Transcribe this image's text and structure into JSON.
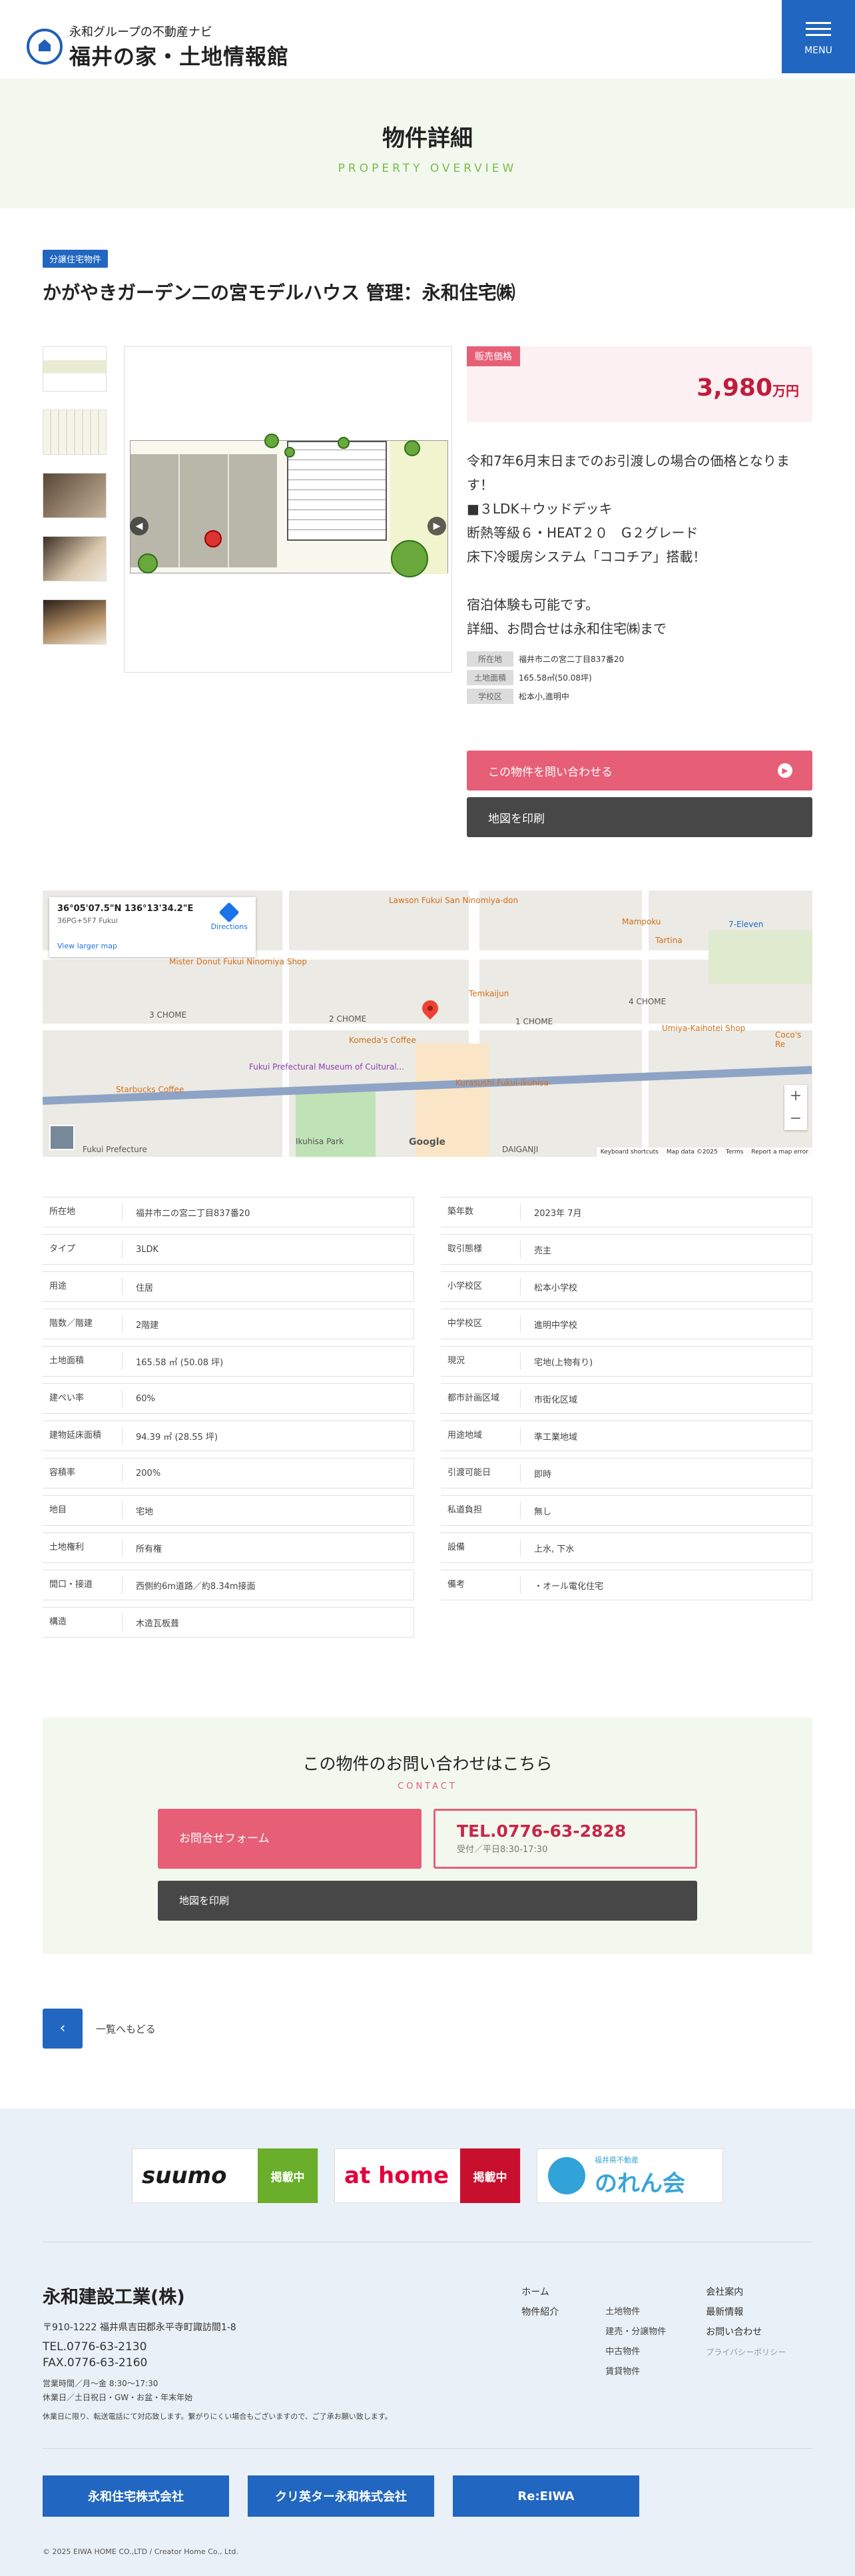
{
  "header": {
    "logo_sub": "永和グループの不動産ナビ",
    "logo_main": "福井の家・土地情報館",
    "menu_label": "MENU"
  },
  "page": {
    "title": "物件詳細",
    "title_en": "PROPERTY OVERVIEW"
  },
  "property": {
    "category": "分譲住宅物件",
    "title": "かがやきガーデン二の宮モデルハウス 管理：永和住宅㈱",
    "price_label": "販売価格",
    "price": "3,980",
    "price_unit": "万円",
    "description": "令和7年6月末日までのお引渡しの場合の価格となります！\n■３LDK＋ウッドデッキ\n断熱等級６・HEAT２０　G２グレード\n床下冷暖房システム「ココチア」搭載！\n\n宿泊体験も可能です。\n詳細、お問合せは永和住宅㈱まで",
    "meta": [
      {
        "k": "所在地",
        "v": "福井市二の宮二丁目837番20"
      },
      {
        "k": "土地面積",
        "v": "165.58㎡(50.08坪)"
      },
      {
        "k": "学校区",
        "v": "松本小,進明中"
      }
    ],
    "inquire_label": "この物件を問い合わせる",
    "print_label": "地図を印刷"
  },
  "map": {
    "coord": "36°05'07.5\"N 136°13'34.2\"E",
    "plus_code": "36PG+5F7 Fukui",
    "larger": "View larger map",
    "directions": "Directions",
    "labels": [
      "Lawson Fukui San Ninomiya-don",
      "Mampoku",
      "Tartina",
      "7-Eleven",
      "Mister Donut Fukui Ninomiya Shop",
      "Temkaijun",
      "Komeda's Coffee",
      "Fukui Prefectural Museum of Cultural...",
      "Starbucks Coffee",
      "Kurasushi Fukui-ikuhisa",
      "Ikuhisa Park",
      "Umiya-Kaihotei Shop",
      "Coco's Re",
      "3 CHOME",
      "2 CHOME",
      "4 CHOME",
      "1 CHOME",
      "DAIGANJI",
      "Fukui Prefecture",
      "Google"
    ],
    "footer": [
      "Keyboard shortcuts",
      "Map data ©2025",
      "Terms",
      "Report a map error"
    ]
  },
  "specs_left": [
    {
      "k": "所在地",
      "v": "福井市二の宮二丁目837番20"
    },
    {
      "k": "タイプ",
      "v": "3LDK"
    },
    {
      "k": "用途",
      "v": "住居"
    },
    {
      "k": "階数／階建",
      "v": "2階建"
    },
    {
      "k": "土地面積",
      "v": "165.58 ㎡ (50.08 坪)"
    },
    {
      "k": "建ぺい率",
      "v": "60%"
    },
    {
      "k": "建物延床面積",
      "v": "94.39 ㎡ (28.55 坪)"
    },
    {
      "k": "容積率",
      "v": "200%"
    },
    {
      "k": "地目",
      "v": "宅地"
    },
    {
      "k": "土地権利",
      "v": "所有権"
    },
    {
      "k": "間口・接道",
      "v": "西側約6m道路／約8.34m接面"
    },
    {
      "k": "構造",
      "v": "木造瓦板葺"
    }
  ],
  "specs_right": [
    {
      "k": "築年数",
      "v": "2023年 7月"
    },
    {
      "k": "取引態様",
      "v": "売主"
    },
    {
      "k": "小学校区",
      "v": "松本小学校"
    },
    {
      "k": "中学校区",
      "v": "進明中学校"
    },
    {
      "k": "現況",
      "v": "宅地(上物有り)"
    },
    {
      "k": "都市計画区域",
      "v": "市街化区域"
    },
    {
      "k": "用途地域",
      "v": "準工業地域"
    },
    {
      "k": "引渡可能日",
      "v": "即時"
    },
    {
      "k": "私道負担",
      "v": "無し"
    },
    {
      "k": "設備",
      "v": "上水, 下水"
    },
    {
      "k": "備考",
      "v": "・オール電化住宅"
    }
  ],
  "contact": {
    "title": "この物件のお問い合わせはこちら",
    "title_en": "CONTACT",
    "form_label": "お問合せフォーム",
    "tel": "TEL.0776-63-2828",
    "hours": "受付／平日8:30-17:30",
    "print_label": "地図を印刷"
  },
  "back_label": "一覧へもどる",
  "banners": {
    "suumo": "suumo",
    "suumo_tag": "掲載中",
    "athome": "at home",
    "athome_tag": "掲載中",
    "norenkai_sub": "福井県不動産",
    "norenkai": "のれん会"
  },
  "footer": {
    "company": "永和建設工業(株)",
    "address": "〒910-1222 福井県吉田郡永平寺町諏訪間1-8",
    "tel": "TEL.0776-63-2130",
    "fax": "FAX.0776-63-2160",
    "hours": "営業時間／月～金 8:30～17:30",
    "holidays": "休業日／土日祝日・GW・お盆・年末年始",
    "note": "休業日に限り、転送電話にて対応致します。繋がりにくい場合もございますので、ご了承お願い致します。",
    "nav1": [
      "ホーム",
      "物件紹介"
    ],
    "nav2": [
      "土地物件",
      "建売・分譲物件",
      "中古物件",
      "賃貸物件"
    ],
    "nav3": [
      "会社案内",
      "最新情報",
      "お問い合わせ"
    ],
    "privacy": "プライバシーポリシー",
    "brands": [
      "永和住宅株式会社",
      "クリ英ター永和株式会社",
      "Re:EIWA"
    ],
    "copyright": "© 2025 EIWA HOME CO.,LTD / Creator Home Co., Ltd."
  }
}
